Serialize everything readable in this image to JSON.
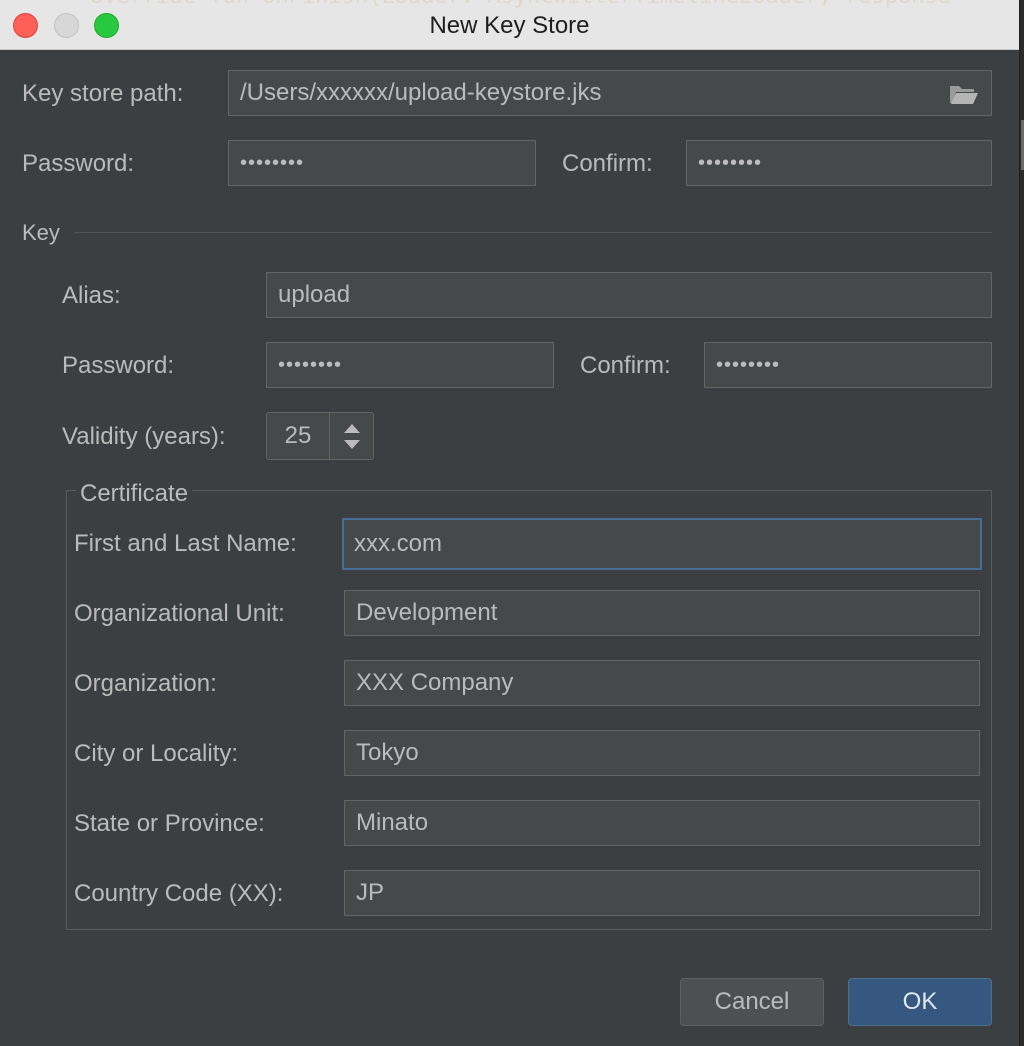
{
  "window": {
    "title": "New Key Store",
    "background_code": "override fun onFinish(Loader: AsyncWitterTimelineLoader, response"
  },
  "keystore": {
    "path_label": "Key store path:",
    "path_value": "/Users/xxxxxx/upload-keystore.jks",
    "password_label": "Password:",
    "password_value": "••••••••",
    "confirm_label": "Confirm:",
    "confirm_value": "••••••••"
  },
  "key": {
    "section_label": "Key",
    "alias_label": "Alias:",
    "alias_value": "upload",
    "password_label": "Password:",
    "password_value": "••••••••",
    "confirm_label": "Confirm:",
    "confirm_value": "••••••••",
    "validity_label": "Validity (years):",
    "validity_value": "25"
  },
  "certificate": {
    "legend": "Certificate",
    "fields": [
      {
        "label": "First and Last Name:",
        "value": "xxx.com"
      },
      {
        "label": "Organizational Unit:",
        "value": "Development"
      },
      {
        "label": "Organization:",
        "value": "XXX Company"
      },
      {
        "label": "City or Locality:",
        "value": "Tokyo"
      },
      {
        "label": "State or Province:",
        "value": "Minato"
      },
      {
        "label": "Country Code (XX):",
        "value": "JP"
      }
    ]
  },
  "buttons": {
    "cancel": "Cancel",
    "ok": "OK"
  },
  "icons": {
    "browse": "folder-icon",
    "spinner": "up-down-arrows-icon"
  },
  "colors": {
    "dialog_bg": "#3c3f41",
    "field_bg": "#45494a",
    "focus_border": "#466d94",
    "ok_button": "#365880",
    "text": "#bbbbbb"
  }
}
